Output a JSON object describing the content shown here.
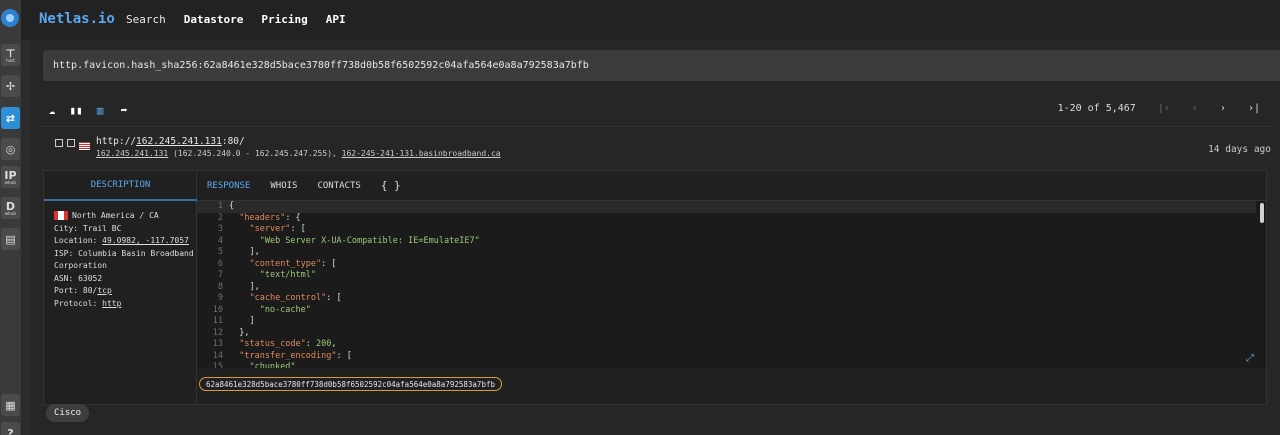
{
  "nav": {
    "brand": "Netlas.io",
    "links": [
      "Search",
      "Datastore",
      "Pricing",
      "API"
    ]
  },
  "rail": {
    "items": [
      "host",
      "graph",
      "search-results",
      "dns",
      "IP",
      "D",
      "file"
    ]
  },
  "search": {
    "query": "http.favicon.hash_sha256:62a8461e328d5bace3780ff738d0b58f6502592c04afa564e0a8a792583a7bfb"
  },
  "pager": {
    "range": "1-20 of 5,467"
  },
  "result": {
    "url_prefix": "http://",
    "url_ip": "162.245.241.131",
    "url_suffix": ":80/",
    "sub_ip": "162.245.241.131",
    "sub_range": " (162.245.240.0 - 162.245.247.255), ",
    "sub_host": "162-245-241-131.basinbroadband.ca",
    "ago": "14 days ago"
  },
  "tabs": {
    "description": "DESCRIPTION",
    "response": "RESPONSE",
    "whois": "WHOIS",
    "contacts": "CONTACTS",
    "raw": "{ }"
  },
  "description": {
    "region": "North America / CA",
    "city": "City: Trail BC",
    "location_label": "Location: ",
    "location_value": "49.0982, -117.7057",
    "isp": "ISP: Columbia Basin Broadband Corporation",
    "asn": "ASN: 63052",
    "port_label": "Port: 80/",
    "port_proto": "tcp",
    "protocol_label": "Protocol: ",
    "protocol_value": "http"
  },
  "code": {
    "line_numbers": [
      "1",
      "2",
      "3",
      "4",
      "5",
      "6",
      "7",
      "8",
      "9",
      "10",
      "11",
      "12",
      "13",
      "14",
      "15"
    ],
    "lines": [
      "{",
      "  \"headers\": {",
      "    \"server\": [",
      "      \"Web Server X-UA-Compatible: IE=EmulateIE7\"",
      "    ],",
      "    \"content_type\": [",
      "      \"text/html\"",
      "    ],",
      "    \"cache_control\": [",
      "      \"no-cache\"",
      "    ]",
      "  },",
      "  \"status_code\": 200,",
      "  \"transfer_encoding\": [",
      "    \"chunked\""
    ]
  },
  "hash_pill": "62a8461e328d5bace3780ff738d0b58f6502592c04afa564e0a8a792583a7bfb",
  "tag": "Cisco"
}
